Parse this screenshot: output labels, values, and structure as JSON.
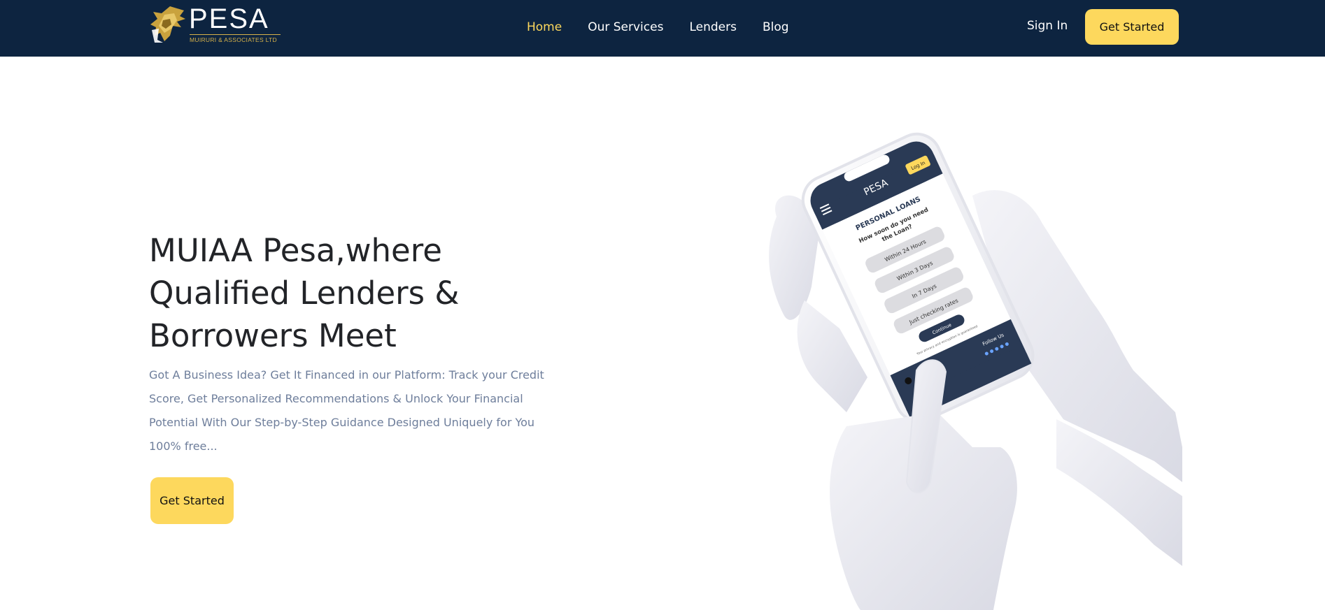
{
  "brand": {
    "name": "PESA",
    "subtitle": "MUIRURI & ASSOCIATES LTD",
    "gold": "#d7b24a"
  },
  "nav": {
    "items": [
      {
        "label": "Home",
        "active": true
      },
      {
        "label": "Our Services",
        "active": false
      },
      {
        "label": "Lenders",
        "active": false
      },
      {
        "label": "Blog",
        "active": false
      }
    ],
    "active_color": "#fdd85d"
  },
  "header": {
    "signin_label": "Sign In",
    "get_started_label": "Get Started",
    "background": "#0d2440"
  },
  "hero": {
    "title": "MUIAA Pesa,where Qualified Lenders & Borrowers Meet",
    "description": "Got A Business Idea? Get It Financed in our Platform: Track your Credit Score, Get Personalized Recommendations & Unlock Your Financial Potential With Our Step-by-Step Guidance Designed Uniquely for You 100% free...",
    "cta_label": "Get Started",
    "accent": "#fdd85d"
  },
  "phone": {
    "login_label": "Log In",
    "brand": "PESA",
    "section_title": "PERSONAL LOANS",
    "question_line1": "How soon do you need",
    "question_line2": "the Loan?",
    "options": [
      "Within 24 Hours",
      "Within 3 Days",
      "In 7 Days",
      "Just checking rates"
    ],
    "continue_label": "Continue",
    "privacy_note": "Your privacy and encryption is guaranteed",
    "follow_label": "Follow Us"
  }
}
